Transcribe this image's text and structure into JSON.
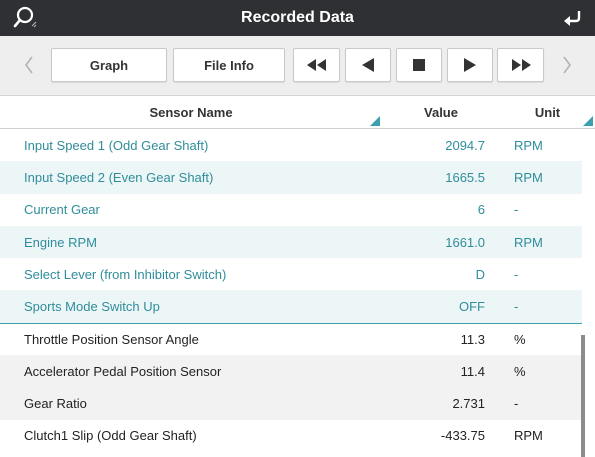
{
  "titlebar": {
    "title": "Recorded Data"
  },
  "toolbar": {
    "graph_label": "Graph",
    "fileinfo_label": "File Info"
  },
  "table": {
    "headers": {
      "name": "Sensor Name",
      "value": "Value",
      "unit": "Unit"
    },
    "rows": [
      {
        "name": "Input Speed 1 (Odd Gear Shaft)",
        "value": "2094.7",
        "unit": "RPM"
      },
      {
        "name": "Input Speed 2 (Even Gear Shaft)",
        "value": "1665.5",
        "unit": "RPM"
      },
      {
        "name": "Current Gear",
        "value": "6",
        "unit": "-"
      },
      {
        "name": "Engine RPM",
        "value": "1661.0",
        "unit": "RPM"
      },
      {
        "name": "Select Lever (from Inhibitor Switch)",
        "value": "D",
        "unit": "-"
      },
      {
        "name": "Sports Mode Switch Up",
        "value": "OFF",
        "unit": "-"
      },
      {
        "name": "Throttle Position Sensor Angle",
        "value": "11.3",
        "unit": "%"
      },
      {
        "name": "Accelerator Pedal Position Sensor",
        "value": "11.4",
        "unit": "%"
      },
      {
        "name": "Gear Ratio",
        "value": "2.731",
        "unit": "-"
      },
      {
        "name": "Clutch1 Slip (Odd Gear Shaft)",
        "value": "-433.75",
        "unit": "RPM"
      }
    ]
  },
  "colors": {
    "titlebar_bg": "#2f3033",
    "selected_text": "#2f8d9b",
    "divider": "#3d9eb0"
  },
  "icons": [
    "search-icon",
    "back-arrow-icon",
    "chevron-left-icon",
    "fast-rewind-icon",
    "step-back-icon",
    "stop-icon",
    "play-icon",
    "fast-forward-icon",
    "chevron-right-icon",
    "sort-indicator-icon"
  ]
}
